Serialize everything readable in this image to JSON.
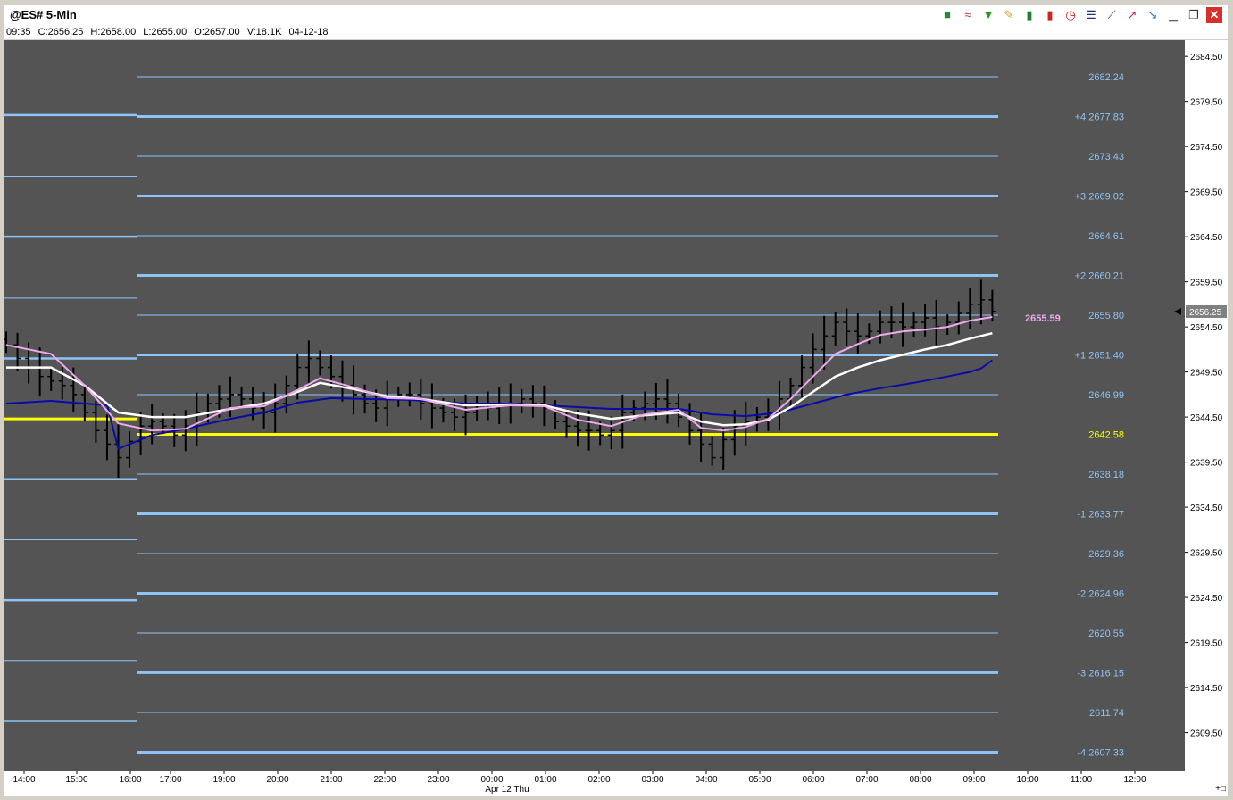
{
  "window": {
    "title": "@ES# 5-Min",
    "toolbar_icons": [
      "cube-icon",
      "rainbow-icon",
      "tree-icon",
      "pencil-icon",
      "bar-chart-icon",
      "candle-icon",
      "clock-icon",
      "list-icon",
      "line-tool-icon",
      "trend-icon",
      "pointer-icon",
      "minimize-icon",
      "restore-icon",
      "close-icon"
    ]
  },
  "quote": {
    "time": "09:35",
    "close": "C:2656.25",
    "high": "H:2658.00",
    "low": "L:2655.00",
    "open": "O:2657.00",
    "volume": "V:18.1K",
    "date": "04-12-18"
  },
  "colors": {
    "plot_bg": "#545454",
    "level_line": "#8ec3f5",
    "pivot_line": "#ffff00",
    "bars": "#000000",
    "ma_pink": "#f0a8f0",
    "ma_white": "#ffffff",
    "ma_blue": "#0a0aa8"
  },
  "chart_data": {
    "type": "line",
    "ylim": [
      2605.3,
      2686.3
    ],
    "y_ticks": [
      "2684.50",
      "2679.50",
      "2674.50",
      "2669.50",
      "2664.50",
      "2659.50",
      "2654.50",
      "2649.50",
      "2644.50",
      "2639.50",
      "2634.50",
      "2629.50",
      "2624.50",
      "2619.50",
      "2614.50",
      "2609.50"
    ],
    "x_ticks": [
      "14:00",
      "15:00",
      "16:00",
      "17:00",
      "19:00",
      "20:00",
      "21:00",
      "22:00",
      "23:00",
      "00:00",
      "01:00",
      "02:00",
      "03:00",
      "04:00",
      "05:00",
      "06:00",
      "07:00",
      "08:00",
      "09:00",
      "10:00",
      "11:00",
      "12:00"
    ],
    "date_label": "Apr 12 Thu",
    "last_price": "2656.25",
    "ma_label": "2655.59",
    "levels": [
      {
        "label": "2682.24",
        "value": 2682.24,
        "thick": false
      },
      {
        "label": "+4 2677.83",
        "value": 2677.83,
        "thick": true
      },
      {
        "label": "2673.43",
        "value": 2673.43,
        "thick": false
      },
      {
        "label": "+3 2669.02",
        "value": 2669.02,
        "thick": true
      },
      {
        "label": "2664.61",
        "value": 2664.61,
        "thick": false
      },
      {
        "label": "+2 2660.21",
        "value": 2660.21,
        "thick": true
      },
      {
        "label": "2655.80",
        "value": 2655.8,
        "thick": false
      },
      {
        "label": "+1 2651.40",
        "value": 2651.4,
        "thick": true
      },
      {
        "label": "2646.99",
        "value": 2646.99,
        "thick": false
      },
      {
        "label": "2642.58",
        "value": 2642.58,
        "thick": true,
        "pivot": true
      },
      {
        "label": "2638.18",
        "value": 2638.18,
        "thick": false
      },
      {
        "label": "-1 2633.77",
        "value": 2633.77,
        "thick": true
      },
      {
        "label": "2629.36",
        "value": 2629.36,
        "thick": false
      },
      {
        "label": "-2 2624.96",
        "value": 2624.96,
        "thick": true
      },
      {
        "label": "2620.55",
        "value": 2620.55,
        "thick": false
      },
      {
        "label": "-3 2616.15",
        "value": 2616.15,
        "thick": true
      },
      {
        "label": "2611.74",
        "value": 2611.74,
        "thick": false
      },
      {
        "label": "-4 2607.33",
        "value": 2607.33,
        "thick": true
      }
    ],
    "prior_levels": [
      2678.0,
      2671.2,
      2664.5,
      2657.7,
      2651.0,
      2644.3,
      2637.6,
      2630.9,
      2624.2,
      2617.5,
      2610.8
    ],
    "prior_pivot": 2644.3,
    "series": [
      {
        "key": "close",
        "points": [
          [
            0,
            2652.5
          ],
          [
            1,
            2651.0
          ],
          [
            2,
            2650.0
          ],
          [
            3,
            2649.0
          ],
          [
            4,
            2648.5
          ],
          [
            5,
            2648.0
          ],
          [
            6,
            2647.0
          ],
          [
            7,
            2645.0
          ],
          [
            8,
            2643.0
          ],
          [
            9,
            2641.5
          ],
          [
            10,
            2640.0
          ],
          [
            11,
            2641.8
          ],
          [
            12,
            2643.5
          ],
          [
            13,
            2644.0
          ],
          [
            14,
            2643.5
          ],
          [
            15,
            2642.5
          ],
          [
            16,
            2643.5
          ],
          [
            17,
            2645.0
          ],
          [
            18,
            2646.0
          ],
          [
            19,
            2646.5
          ],
          [
            20,
            2647.0
          ],
          [
            21,
            2646.5
          ],
          [
            22,
            2645.5
          ],
          [
            23,
            2645.0
          ],
          [
            24,
            2646.0
          ],
          [
            25,
            2648.0
          ],
          [
            26,
            2650.0
          ],
          [
            27,
            2651.0
          ],
          [
            28,
            2650.0
          ],
          [
            29,
            2649.0
          ],
          [
            30,
            2648.0
          ],
          [
            31,
            2647.0
          ],
          [
            32,
            2646.0
          ],
          [
            33,
            2645.5
          ],
          [
            34,
            2646.5
          ],
          [
            35,
            2647.0
          ],
          [
            36,
            2647.0
          ],
          [
            37,
            2646.0
          ],
          [
            38,
            2645.5
          ],
          [
            39,
            2645.0
          ],
          [
            40,
            2644.5
          ],
          [
            41,
            2645.0
          ],
          [
            42,
            2646.0
          ],
          [
            43,
            2645.5
          ],
          [
            44,
            2646.0
          ],
          [
            45,
            2646.0
          ],
          [
            46,
            2646.5
          ],
          [
            47,
            2646.0
          ],
          [
            48,
            2645.5
          ],
          [
            49,
            2644.0
          ],
          [
            50,
            2643.5
          ],
          [
            51,
            2643.0
          ],
          [
            52,
            2643.0
          ],
          [
            53,
            2642.5
          ],
          [
            54,
            2643.0
          ],
          [
            55,
            2645.0
          ],
          [
            56,
            2645.5
          ],
          [
            57,
            2646.0
          ],
          [
            58,
            2646.5
          ],
          [
            59,
            2646.0
          ],
          [
            60,
            2644.5
          ],
          [
            61,
            2643.0
          ],
          [
            62,
            2641.5
          ],
          [
            63,
            2640.0
          ],
          [
            64,
            2642.0
          ],
          [
            65,
            2643.5
          ],
          [
            66,
            2644.0
          ],
          [
            67,
            2644.5
          ],
          [
            68,
            2645.0
          ],
          [
            69,
            2646.5
          ],
          [
            70,
            2648.0
          ],
          [
            71,
            2650.0
          ],
          [
            72,
            2652.0
          ],
          [
            73,
            2653.5
          ],
          [
            74,
            2655.0
          ],
          [
            75,
            2654.0
          ],
          [
            76,
            2653.5
          ],
          [
            77,
            2654.0
          ],
          [
            78,
            2655.0
          ],
          [
            79,
            2655.0
          ],
          [
            80,
            2654.5
          ],
          [
            81,
            2655.0
          ],
          [
            82,
            2655.5
          ],
          [
            83,
            2654.5
          ],
          [
            84,
            2655.0
          ],
          [
            85,
            2656.0
          ],
          [
            86,
            2657.0
          ],
          [
            87,
            2657.5
          ],
          [
            88,
            2656.2
          ]
        ]
      },
      {
        "key": "ma_pink",
        "points": [
          [
            0,
            2652.5
          ],
          [
            4,
            2651.5
          ],
          [
            7,
            2648.0
          ],
          [
            10,
            2643.8
          ],
          [
            13,
            2643.0
          ],
          [
            16,
            2643.2
          ],
          [
            20,
            2645.5
          ],
          [
            23,
            2645.7
          ],
          [
            26,
            2647.5
          ],
          [
            28,
            2648.8
          ],
          [
            31,
            2647.8
          ],
          [
            34,
            2646.6
          ],
          [
            37,
            2646.5
          ],
          [
            41,
            2645.3
          ],
          [
            45,
            2645.8
          ],
          [
            48,
            2645.7
          ],
          [
            51,
            2644.2
          ],
          [
            54,
            2643.5
          ],
          [
            57,
            2644.8
          ],
          [
            60,
            2645.3
          ],
          [
            62,
            2643.3
          ],
          [
            64,
            2643.0
          ],
          [
            66,
            2643.4
          ],
          [
            68,
            2644.3
          ],
          [
            70,
            2646.5
          ],
          [
            72,
            2649.0
          ],
          [
            74,
            2651.5
          ],
          [
            76,
            2652.6
          ],
          [
            78,
            2653.6
          ],
          [
            80,
            2654.0
          ],
          [
            82,
            2654.2
          ],
          [
            84,
            2654.5
          ],
          [
            86,
            2655.2
          ],
          [
            88,
            2655.6
          ]
        ]
      },
      {
        "key": "ma_white",
        "points": [
          [
            0,
            2650.0
          ],
          [
            4,
            2650.0
          ],
          [
            7,
            2648.0
          ],
          [
            10,
            2645.0
          ],
          [
            13,
            2644.5
          ],
          [
            16,
            2644.5
          ],
          [
            20,
            2645.4
          ],
          [
            23,
            2646.0
          ],
          [
            26,
            2647.3
          ],
          [
            28,
            2648.3
          ],
          [
            31,
            2647.6
          ],
          [
            34,
            2646.8
          ],
          [
            37,
            2646.5
          ],
          [
            41,
            2645.8
          ],
          [
            45,
            2645.9
          ],
          [
            48,
            2645.8
          ],
          [
            51,
            2644.9
          ],
          [
            54,
            2644.3
          ],
          [
            57,
            2644.7
          ],
          [
            60,
            2645.0
          ],
          [
            62,
            2644.0
          ],
          [
            64,
            2643.6
          ],
          [
            66,
            2643.7
          ],
          [
            68,
            2644.2
          ],
          [
            70,
            2645.6
          ],
          [
            72,
            2647.3
          ],
          [
            74,
            2649.0
          ],
          [
            76,
            2650.0
          ],
          [
            78,
            2650.8
          ],
          [
            80,
            2651.4
          ],
          [
            82,
            2652.0
          ],
          [
            84,
            2652.5
          ],
          [
            86,
            2653.2
          ],
          [
            88,
            2653.8
          ]
        ]
      },
      {
        "key": "ma_blue",
        "points": [
          [
            0,
            2646.0
          ],
          [
            4,
            2646.3
          ],
          [
            7,
            2646.0
          ],
          [
            9,
            2645.8
          ],
          [
            10,
            2641.0
          ],
          [
            13,
            2642.5
          ],
          [
            16,
            2643.2
          ],
          [
            20,
            2644.3
          ],
          [
            23,
            2645.0
          ],
          [
            26,
            2646.1
          ],
          [
            29,
            2646.6
          ],
          [
            32,
            2646.5
          ],
          [
            36,
            2646.4
          ],
          [
            41,
            2646.0
          ],
          [
            45,
            2646.0
          ],
          [
            48,
            2645.8
          ],
          [
            51,
            2645.6
          ],
          [
            54,
            2645.4
          ],
          [
            57,
            2645.4
          ],
          [
            60,
            2645.4
          ],
          [
            63,
            2644.8
          ],
          [
            66,
            2644.6
          ],
          [
            69,
            2645.0
          ],
          [
            72,
            2646.0
          ],
          [
            75,
            2647.0
          ],
          [
            78,
            2647.7
          ],
          [
            81,
            2648.3
          ],
          [
            84,
            2649.0
          ],
          [
            86,
            2649.5
          ],
          [
            87,
            2649.9
          ],
          [
            88,
            2650.8
          ]
        ]
      }
    ]
  }
}
